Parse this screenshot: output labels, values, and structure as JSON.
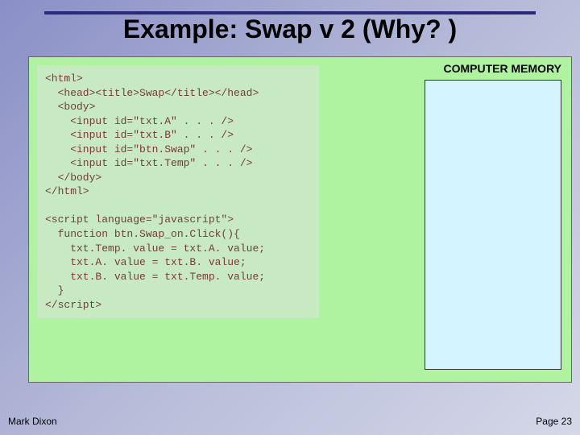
{
  "slide": {
    "title": "Example: Swap v 2 (Why? )"
  },
  "code": {
    "lines": "<html>\n  <head><title>Swap</title></head>\n  <body>\n    <input id=\"txt.A\" . . . />\n    <input id=\"txt.B\" . . . />\n    <input id=\"btn.Swap\" . . . />\n    <input id=\"txt.Temp\" . . . />\n  </body>\n</html>\n\n<script language=\"javascript\">\n  function btn.Swap_on.Click(){\n    txt.Temp. value = txt.A. value;\n    txt.A. value = txt.B. value;\n    txt.B. value = txt.Temp. value;\n  }\n</script>"
  },
  "memory": {
    "label": "COMPUTER MEMORY"
  },
  "footer": {
    "author": "Mark Dixon",
    "page": "Page 23"
  }
}
